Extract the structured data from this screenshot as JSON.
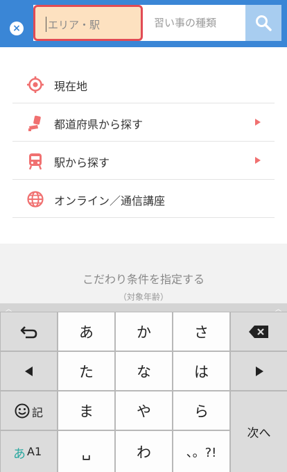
{
  "header": {
    "close": "×",
    "area_placeholder": "エリア・駅",
    "lesson_placeholder": "習い事の種類"
  },
  "menu": [
    {
      "label": "現在地",
      "icon": "location-target-icon",
      "arrow": false
    },
    {
      "label": "都道府県から探す",
      "icon": "seat-icon",
      "arrow": true
    },
    {
      "label": "駅から探す",
      "icon": "train-icon",
      "arrow": true
    },
    {
      "label": "オンライン／通信講座",
      "icon": "globe-icon",
      "arrow": false
    }
  ],
  "conditions": {
    "title": "こだわり条件を指定する",
    "subtitle": "（対象年齢）"
  },
  "keyboard": {
    "row1": [
      "あ",
      "か",
      "さ"
    ],
    "row2": [
      "た",
      "な",
      "は"
    ],
    "row3": [
      "ま",
      "や",
      "ら"
    ],
    "row4": [
      "␣",
      "わ",
      "、。?!"
    ],
    "emoji_label": "記",
    "mode_label_a": "あ",
    "mode_label_b": "A1",
    "enter_label": "次へ"
  },
  "colors": {
    "header": "#3a86d6",
    "accent_icon": "#f07070",
    "highlight_border": "#e14b55",
    "highlight_fill": "#fde1c0"
  }
}
